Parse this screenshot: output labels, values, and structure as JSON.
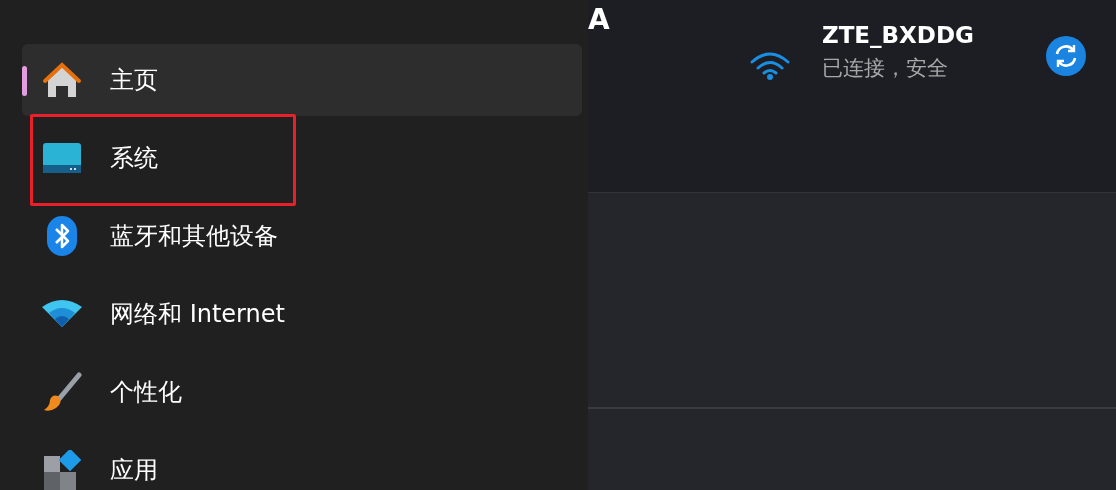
{
  "sidebar": {
    "items": [
      {
        "label": "主页",
        "kind": "home",
        "selected": true,
        "annotated": false
      },
      {
        "label": "系统",
        "kind": "system",
        "selected": false,
        "annotated": true
      },
      {
        "label": "蓝牙和其他设备",
        "kind": "bluetooth",
        "selected": false,
        "annotated": false
      },
      {
        "label": "网络和 Internet",
        "kind": "network",
        "selected": false,
        "annotated": false
      },
      {
        "label": "个性化",
        "kind": "brush",
        "selected": false,
        "annotated": false
      },
      {
        "label": "应用",
        "kind": "apps",
        "selected": false,
        "annotated": false
      }
    ]
  },
  "header": {
    "title": "A"
  },
  "network": {
    "name": "ZTE_BXDDG",
    "status": "已连接，安全"
  }
}
